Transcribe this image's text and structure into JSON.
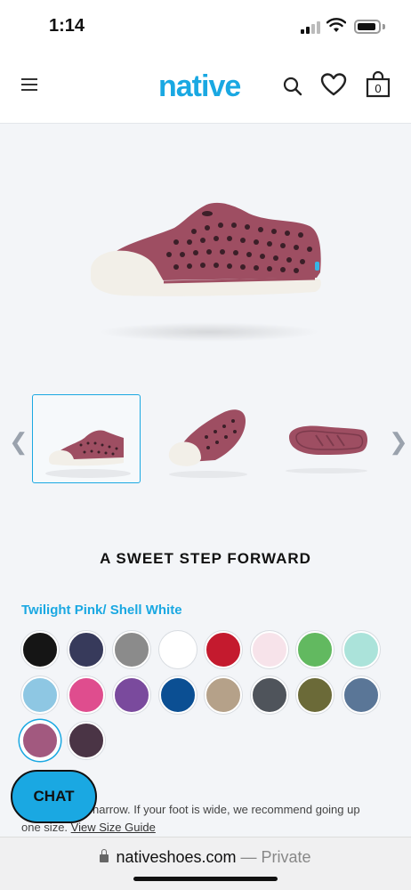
{
  "status_bar": {
    "time": "1:14"
  },
  "header": {
    "logo": "native",
    "bag_count": "0",
    "icons": [
      "menu-icon",
      "search-icon",
      "heart-icon",
      "bag-icon"
    ]
  },
  "product": {
    "tagline": "A SWEET STEP FORWARD",
    "selected_color": "Twilight Pink/ Shell White",
    "shoe_color": "#9e4e62",
    "sole_color": "#f2efe8"
  },
  "swatches": [
    "#151515",
    "#373a5b",
    "#8b8b8b",
    "#ffffff",
    "#c41a2e",
    "#f7e3ea",
    "#62b960",
    "#abe3da",
    "#8ec7e3",
    "#df4d8e",
    "#7a4a9d",
    "#0b4f93",
    "#b5a189",
    "#4f545b",
    "#6b6a38",
    "#5a7697",
    "#a2597f",
    "#4a3445"
  ],
  "selected_swatch_index": 16,
  "size_note": {
    "text_part1": "narrow. If your foot is wide, we recommend going up",
    "text_part2": "one size.",
    "link": "View Size Guide"
  },
  "chat": {
    "label": "CHAT"
  },
  "browser": {
    "domain": "nativeshoes.com",
    "separator": " — ",
    "mode": "Private"
  }
}
